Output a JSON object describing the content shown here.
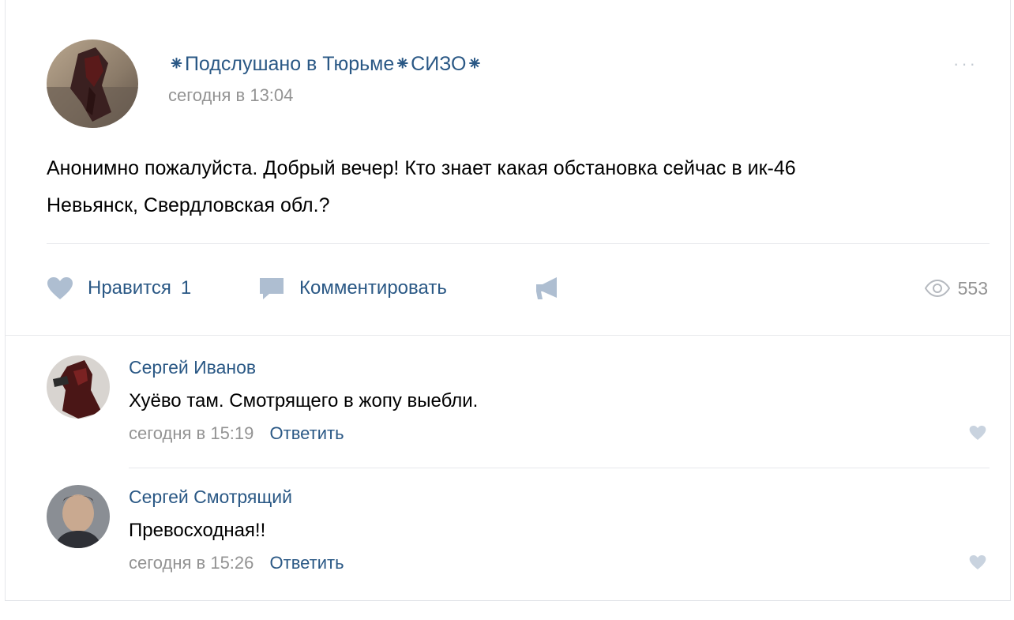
{
  "post": {
    "author": "⁕Подслушано в Тюрьме⁕СИЗО⁕",
    "time": "сегодня в 13:04",
    "more_icon": "ellipsis-icon",
    "more_label": "···",
    "text_lines": [
      "Анонимно пожалуйста. Добрый вечер! Кто знает какая обстановка сейчас в ик-46",
      "Невьянск, Свердловская обл.?"
    ],
    "actions": {
      "like_label": "Нравится",
      "like_count": "1",
      "comment_label": "Комментировать",
      "share_icon": "megaphone-icon",
      "views_count": "553"
    }
  },
  "comments": [
    {
      "author": "Сергей Иванов",
      "text": "Хуёво там. Смотрящего в жопу выебли.",
      "time": "сегодня в 15:19",
      "reply_label": "Ответить"
    },
    {
      "author": "Сергей Смотрящий",
      "text": "Превосходная!!",
      "time": "сегодня в 15:26",
      "reply_label": "Ответить"
    }
  ],
  "colors": {
    "link": "#2a5885",
    "muted": "#939393",
    "icon": "#aebed1",
    "divider": "#e7e8ec"
  }
}
